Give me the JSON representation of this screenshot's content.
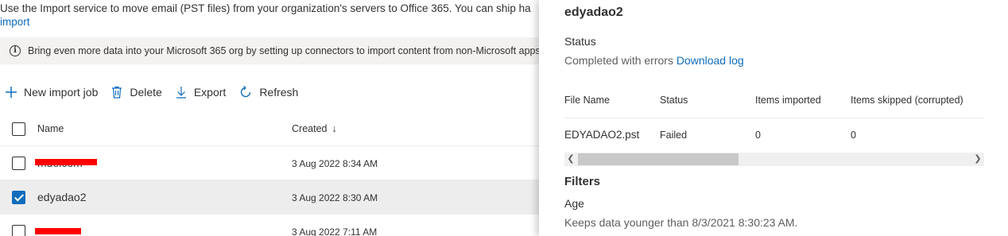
{
  "page": {
    "intro_text": "Use the Import service to move email (PST files) from your organization's servers to Office 365. You can ship ha",
    "intro_link": "import",
    "info_banner": "Bring even more data into your Microsoft 365 org by setting up connectors to import content from non-Microsoft apps lik"
  },
  "toolbar": {
    "new_label": "New import job",
    "delete_label": "Delete",
    "export_label": "Export",
    "refresh_label": "Refresh"
  },
  "table": {
    "col_name": "Name",
    "col_created": "Created",
    "sort_arrow": "↓",
    "rows": [
      {
        "name": "muelcom",
        "created": "3 Aug 2022 8:34 AM",
        "selected": false,
        "redacted": true
      },
      {
        "name": "edyadao2",
        "created": "3 Aug 2022 8:30 AM",
        "selected": true,
        "redacted": false
      },
      {
        "name": "",
        "created": "3 Aug 2022 7:11 AM",
        "selected": false,
        "redacted": true
      }
    ]
  },
  "panel": {
    "title": "edyadao2",
    "status_label": "Status",
    "status_value": "Completed with errors",
    "download_link": "Download log",
    "columns": {
      "file_name": "File Name",
      "status": "Status",
      "items_imported": "Items imported",
      "items_skipped": "Items skipped (corrupted)"
    },
    "file_row": {
      "file_name": "EDYADAO2.pst",
      "status": "Failed",
      "items_imported": "0",
      "items_skipped": "0"
    },
    "filters_heading": "Filters",
    "age_label": "Age",
    "age_value": "Keeps data younger than 8/3/2021 8:30:23 AM."
  },
  "colors": {
    "accent": "#0f6cbd",
    "redaction": "#ff0000",
    "selected_row": "#ededed"
  }
}
